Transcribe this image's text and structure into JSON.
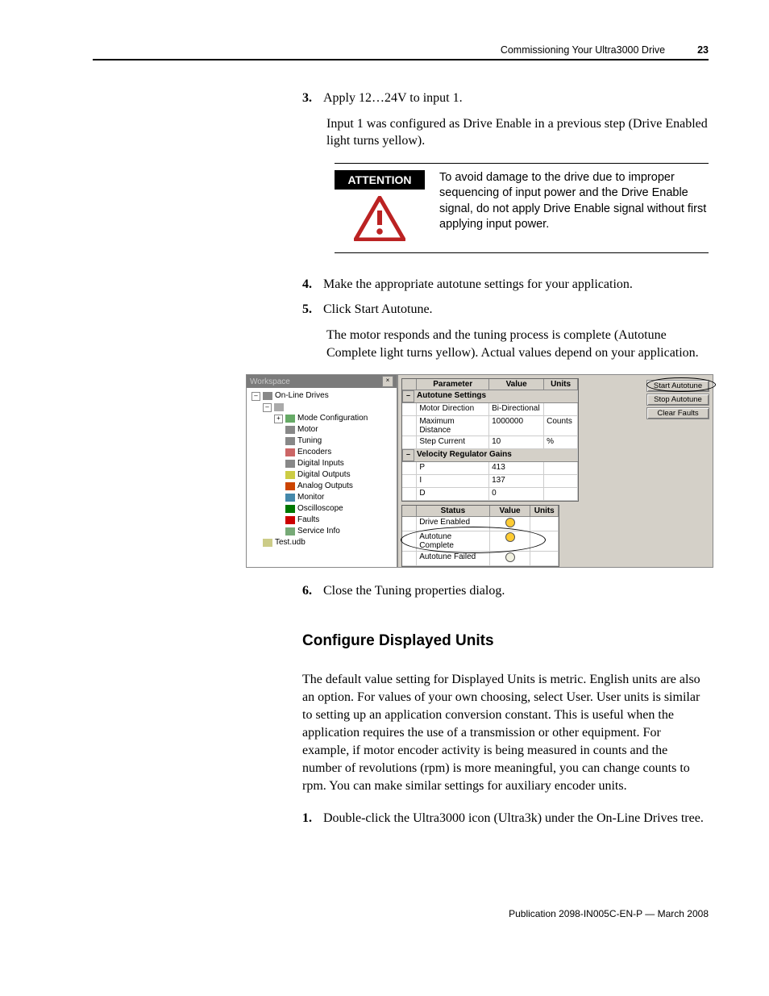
{
  "header": {
    "title": "Commissioning Your Ultra3000 Drive",
    "page": "23"
  },
  "steps": {
    "s3": {
      "num": "3.",
      "text": "Apply 12…24V to input 1."
    },
    "s3_follow": "Input 1 was configured as Drive Enable in a previous step (Drive Enabled light turns yellow).",
    "s4": {
      "num": "4.",
      "text": "Make the appropriate autotune settings for your application."
    },
    "s5": {
      "num": "5.",
      "text": "Click Start Autotune."
    },
    "s5_follow": "The motor responds and the tuning process is complete (Autotune Complete light turns yellow). Actual values depend on your application.",
    "s6": {
      "num": "6.",
      "text": "Close the Tuning properties dialog."
    },
    "s1b": {
      "num": "1.",
      "text": "Double-click the Ultra3000 icon (Ultra3k) under the On-Line Drives tree."
    }
  },
  "attention": {
    "label": "ATTENTION",
    "text": "To avoid damage to the drive due to improper sequencing of input power and the Drive Enable signal, do not apply Drive Enable signal without first applying input power."
  },
  "screenshot": {
    "workspace_title": "Workspace",
    "tree": {
      "root": "On-Line Drives",
      "items": [
        "Mode Configuration",
        "Motor",
        "Tuning",
        "Encoders",
        "Digital Inputs",
        "Digital Outputs",
        "Analog Outputs",
        "Monitor",
        "Oscilloscope",
        "Faults",
        "Service Info"
      ],
      "test": "Test.udb"
    },
    "headers": {
      "param": "Parameter",
      "value": "Value",
      "units": "Units",
      "status": "Status"
    },
    "sections": {
      "autotune": "Autotune Settings",
      "velocity": "Velocity Regulator Gains"
    },
    "rows": {
      "motor_dir": {
        "p": "Motor Direction",
        "v": "Bi-Directional",
        "u": ""
      },
      "max_dist": {
        "p": "Maximum Distance",
        "v": "1000000",
        "u": "Counts"
      },
      "step_cur": {
        "p": "Step Current",
        "v": "10",
        "u": "%"
      },
      "p": {
        "p": "P",
        "v": "413",
        "u": ""
      },
      "i": {
        "p": "I",
        "v": "137",
        "u": ""
      },
      "d": {
        "p": "D",
        "v": "0",
        "u": ""
      }
    },
    "status": {
      "drive_enabled": "Drive Enabled",
      "autotune_complete": "Autotune Complete",
      "autotune_failed": "Autotune Failed"
    },
    "buttons": {
      "start": "Start Autotune",
      "stop": "Stop Autotune",
      "clear": "Clear Faults"
    }
  },
  "section_heading": "Configure Displayed Units",
  "section_para": "The default value setting for Displayed Units is metric. English units are also an option. For values of your own choosing, select User. User units is similar to setting up an application conversion constant. This is useful when the application requires the use of a transmission or other equipment. For example, if motor encoder activity is being measured in counts and the number of revolutions (rpm) is more meaningful, you can change counts to rpm. You can make similar settings for auxiliary encoder units.",
  "footer": "Publication 2098-IN005C-EN-P — March 2008"
}
